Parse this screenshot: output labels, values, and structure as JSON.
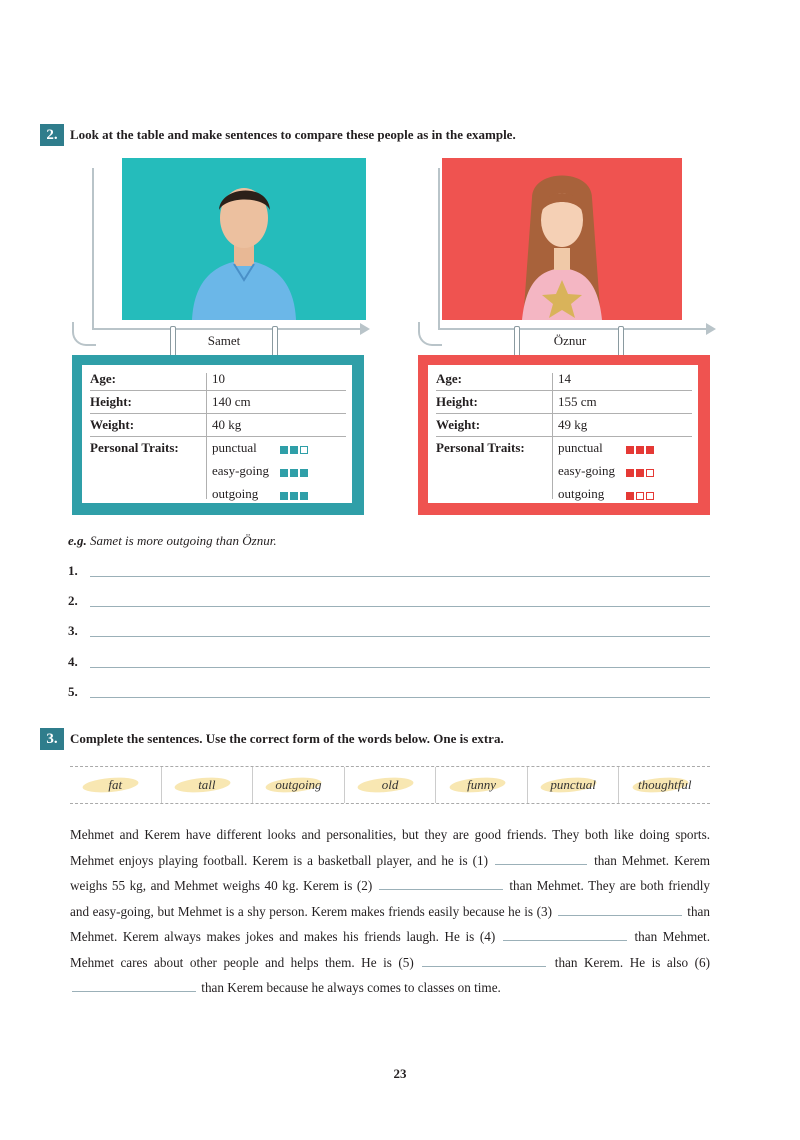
{
  "exercise2": {
    "number": "2.",
    "instruction": "Look at the table and make sentences to compare these people as in the example.",
    "people": [
      {
        "name": "Samet",
        "color": "#2f9fa8",
        "age_label": "Age:",
        "age": "10",
        "height_label": "Height:",
        "height": "140 cm",
        "weight_label": "Weight:",
        "weight": "40 kg",
        "traits_label": "Personal Traits:",
        "traits": [
          {
            "name": "punctual",
            "level": 2,
            "max": 3
          },
          {
            "name": "easy-going",
            "level": 3,
            "max": 3
          },
          {
            "name": "outgoing",
            "level": 3,
            "max": 3
          }
        ]
      },
      {
        "name": "Öznur",
        "color": "#e53935",
        "age_label": "Age:",
        "age": "14",
        "height_label": "Height:",
        "height": "155 cm",
        "weight_label": "Weight:",
        "weight": "49 kg",
        "traits_label": "Personal Traits:",
        "traits": [
          {
            "name": "punctual",
            "level": 3,
            "max": 3
          },
          {
            "name": "easy-going",
            "level": 2,
            "max": 3
          },
          {
            "name": "outgoing",
            "level": 1,
            "max": 3
          }
        ]
      }
    ],
    "example_prefix": "e.g.",
    "example_text": "Samet is more outgoing than Öznur.",
    "answers": [
      "1.",
      "2.",
      "3.",
      "4.",
      "5."
    ]
  },
  "exercise3": {
    "number": "3.",
    "instruction": "Complete the sentences. Use the correct form of the words below. One is extra.",
    "words": [
      "fat",
      "tall",
      "outgoing",
      "old",
      "funny",
      "punctual",
      "thoughtful"
    ],
    "p": [
      "Mehmet and Kerem have different looks and personalities, but they are good friends. They both like doing sports. Mehmet enjoys playing football. Kerem is a basketball player, and he is (1)",
      "than Mehmet. Kerem weighs 55 kg, and Mehmet weighs 40 kg. Kerem is (2)",
      "than Mehmet. They are both friendly and easy-going, but Mehmet is a shy person. Kerem makes friends easily because he is (3)",
      "than Mehmet. Kerem always makes jokes and makes his friends laugh. He is (4)",
      "than Mehmet. Mehmet cares about other people and helps them. He is (5)",
      "than Kerem. He is also (6)",
      "than Kerem because he always comes to classes on time."
    ]
  },
  "page_number": "23"
}
